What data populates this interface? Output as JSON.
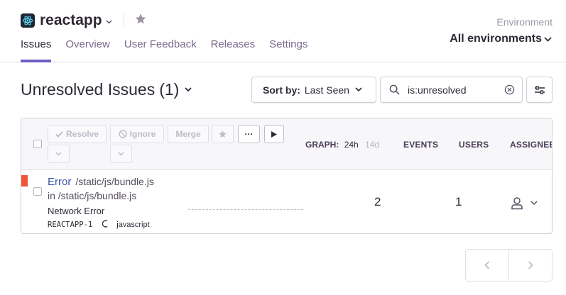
{
  "header": {
    "project_name": "reactapp",
    "environment_label": "Environment",
    "environment_value": "All environments",
    "tabs": [
      {
        "label": "Issues",
        "active": true
      },
      {
        "label": "Overview",
        "active": false
      },
      {
        "label": "User Feedback",
        "active": false
      },
      {
        "label": "Releases",
        "active": false
      },
      {
        "label": "Settings",
        "active": false
      }
    ]
  },
  "issues": {
    "title": "Unresolved Issues",
    "count": "(1)",
    "sort_label": "Sort by:",
    "sort_value": "Last Seen",
    "search_value": "is:unresolved"
  },
  "table": {
    "actions": {
      "resolve": "Resolve",
      "ignore": "Ignore",
      "merge": "Merge",
      "more": "···"
    },
    "columns": {
      "graph": "GRAPH:",
      "graph_24h": "24h",
      "graph_14d": "14d",
      "events": "EVENTS",
      "users": "USERS",
      "assignee": "ASSIGNEE"
    },
    "rows": [
      {
        "type": "Error",
        "location": "/static/js/bundle.js",
        "culprit": "in /static/js/bundle.js",
        "message": "Network Error",
        "short_id": "REACTAPP-1",
        "platform": "javascript",
        "events": "2",
        "users": "1"
      }
    ]
  },
  "colors": {
    "accent": "#6c5fc7",
    "error_level": "#f05538",
    "link": "#3b55a8"
  },
  "icons": [
    "react-logo-icon",
    "star-icon",
    "chevron-down-icon",
    "search-icon",
    "clear-icon",
    "filter-sliders-icon",
    "check-icon",
    "ignore-icon",
    "play-icon",
    "user-icon",
    "chevron-left-icon",
    "chevron-right-icon"
  ]
}
